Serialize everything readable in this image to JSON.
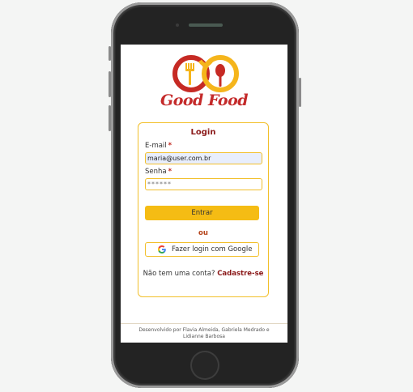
{
  "brand": {
    "name": "Good Food",
    "logo_icon": "fork-spoon-infinity-logo"
  },
  "login": {
    "title": "Login",
    "email_label": "E-mail",
    "email_required": "*",
    "email_value": "maria@user.com.br",
    "password_label": "Senha",
    "password_required": "*",
    "password_value": "******",
    "submit_label": "Entrar",
    "or_text": "ou",
    "google_label": "Fazer login com Google",
    "google_icon": "google-g-icon",
    "signup_prompt": "Não tem uma conta?",
    "signup_link": "Cadastre-se"
  },
  "footer": {
    "credits": "Desenvolvido por Flavia Almeida, Gabriela Medrado e Lidianne Barbosa"
  },
  "colors": {
    "accent": "#f5bc14",
    "brand_red": "#c42a2a",
    "title_red": "#8b1a1a"
  }
}
